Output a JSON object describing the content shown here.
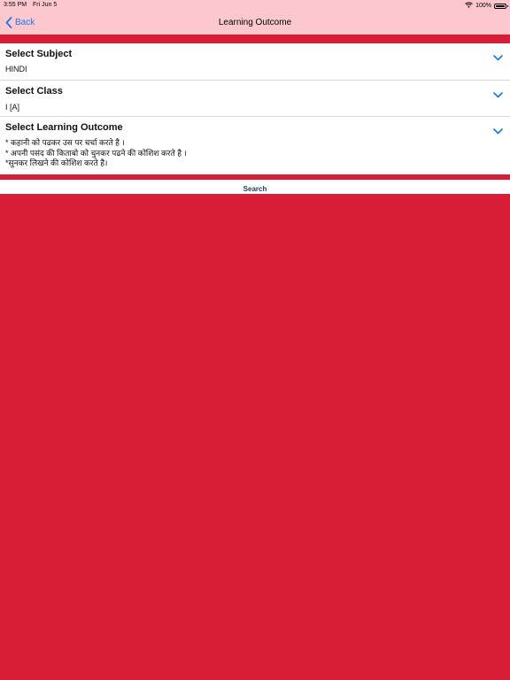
{
  "status_bar": {
    "time": "3:55 PM",
    "date": "Fri Jun 5",
    "battery": "100%",
    "battery_level": 1.0
  },
  "nav": {
    "back_label": "Back",
    "title": "Learning Outcome"
  },
  "subject": {
    "title": "Select Subject",
    "value": "HINDI"
  },
  "class": {
    "title": "Select Class",
    "value": "I [A]"
  },
  "outcome": {
    "title": "Select Learning Outcome",
    "lines": [
      "* कहानी को पढकर उस पर चर्चा करते है ।",
      "* अपनी पसंद की किताबो को चुनकर पढने की कोशिश करते है ।",
      "*सुनकर लिखने की कोशिश करते है।"
    ]
  },
  "search": {
    "label": "Search"
  },
  "colors": {
    "accent_red": "#d81d36",
    "nav_pink": "#fcc8ce",
    "link_blue": "#1877e8"
  },
  "icons": {
    "back": "chevron-left-icon",
    "expand": "chevron-down-icon",
    "wifi": "wifi-icon",
    "battery": "battery-icon"
  }
}
